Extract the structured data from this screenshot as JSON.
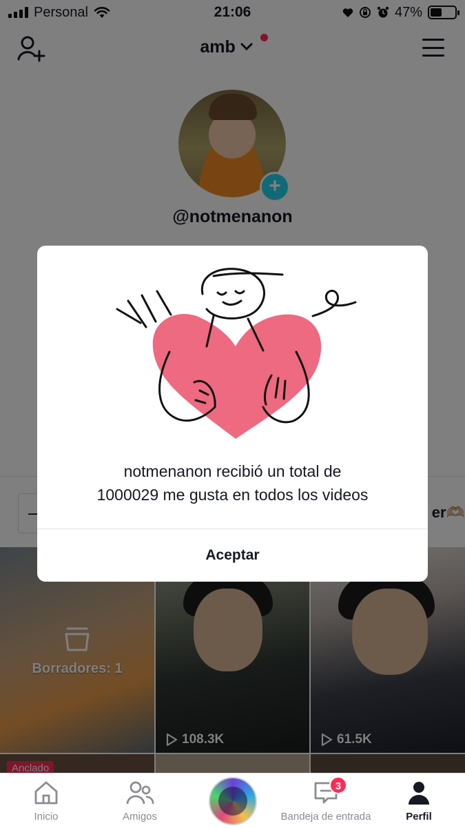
{
  "status_bar": {
    "carrier": "Personal",
    "time": "21:06",
    "battery_percent": "47%",
    "battery_level": 0.47
  },
  "header": {
    "account_name": "amb",
    "notification_dot_color": "#fe2c55"
  },
  "profile": {
    "username": "@notmenanon"
  },
  "partial": {
    "right_chip": "er🫶🏼"
  },
  "grid": {
    "drafts_label": "Borradores: 1",
    "tiles": [
      {
        "views": "108.3K"
      },
      {
        "views": "61.5K"
      }
    ],
    "pinned_label": "Anclado"
  },
  "modal": {
    "message_line1": "notmenanon recibió un total de",
    "message_line2": "1000029 me gusta en todos los videos",
    "accept_label": "Aceptar",
    "heart_color": "#ee6a80"
  },
  "bottom_nav": {
    "home": "Inicio",
    "friends": "Amigos",
    "inbox": "Bandeja de entrada",
    "inbox_badge": "3",
    "profile": "Perfil"
  }
}
